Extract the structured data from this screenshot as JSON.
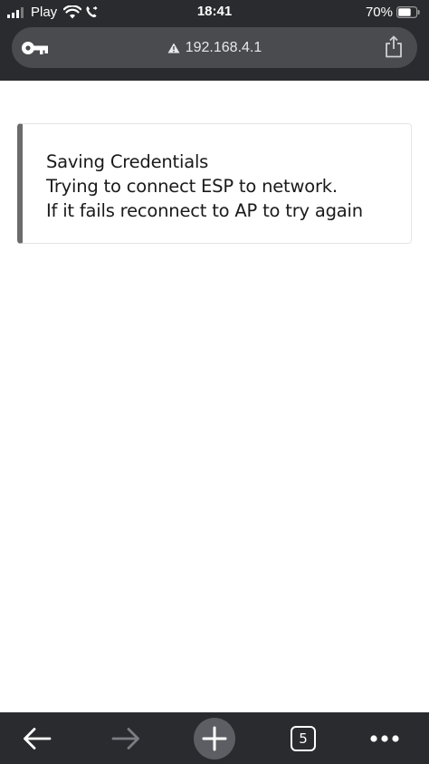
{
  "status_bar": {
    "carrier": "Play",
    "time": "18:41",
    "battery": "70%",
    "icons": [
      "signal-icon",
      "wifi-icon",
      "call-icon",
      "battery-icon"
    ]
  },
  "address_bar": {
    "url": "192.168.4.1",
    "icons": [
      "key-icon",
      "warning-icon",
      "share-icon"
    ]
  },
  "message": {
    "lines": [
      "Saving Credentials",
      "Trying to connect ESP to network.",
      "If it fails reconnect to AP to try again"
    ]
  },
  "toolbar": {
    "tab_count": "5",
    "icons": [
      "back-arrow-icon",
      "forward-arrow-icon",
      "plus-icon",
      "tabs-icon",
      "more-icon"
    ]
  },
  "colors": {
    "chrome": "#2a2b2f",
    "address_bar": "#4a4b4f",
    "message_accent": "#6b6b6b"
  }
}
